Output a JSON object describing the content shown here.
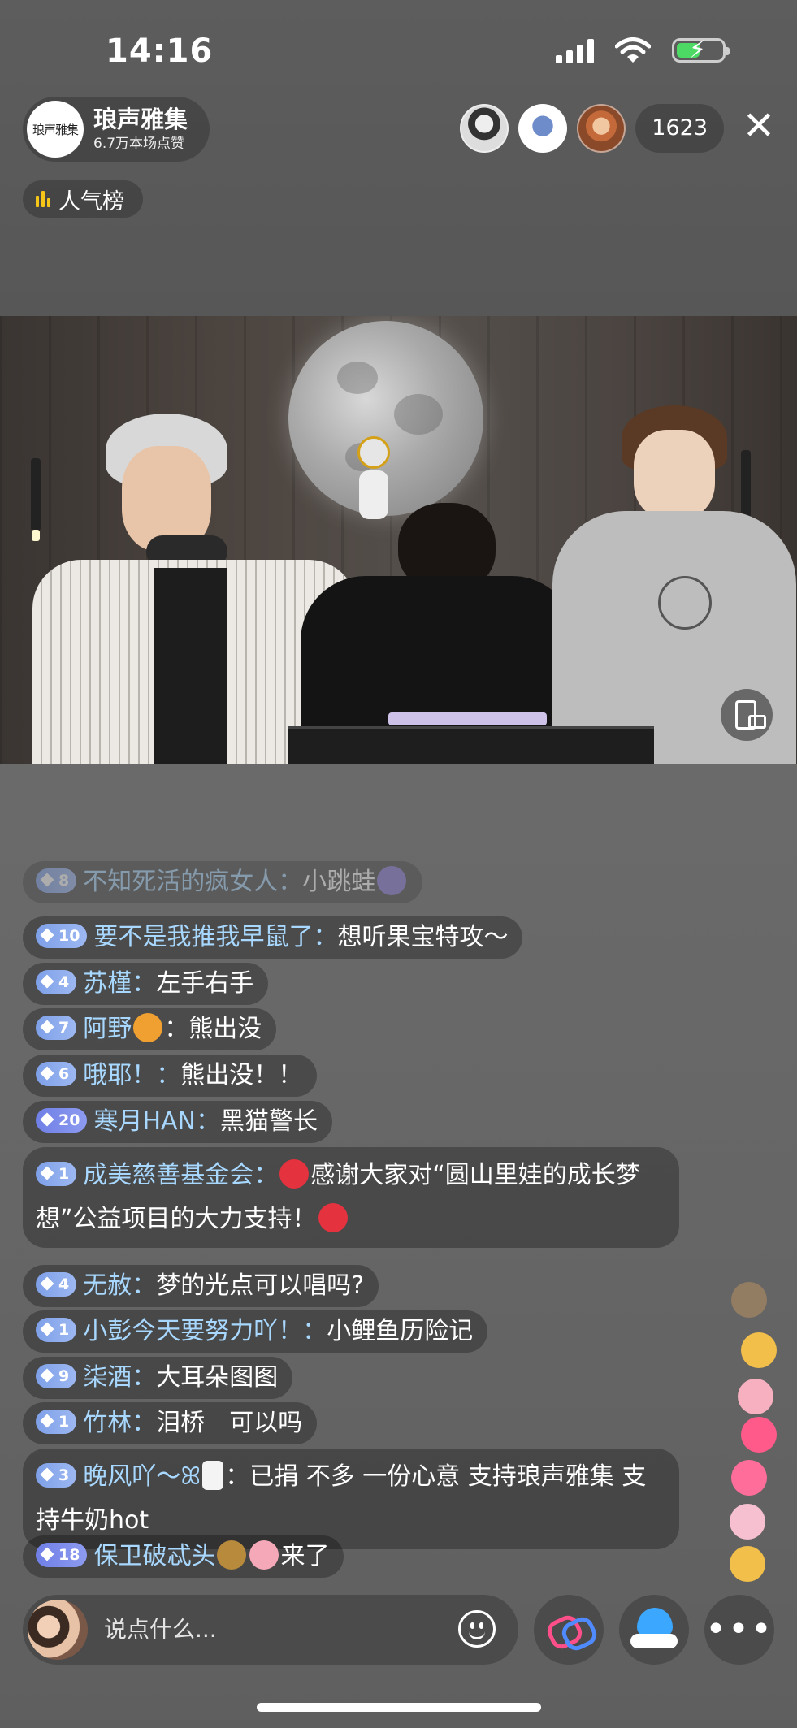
{
  "status": {
    "time": "14:16"
  },
  "host": {
    "avatar_text": "琅声雅集",
    "name": "琅声雅集",
    "likes": "6.7万本场点赞"
  },
  "viewers": {
    "count": "1623"
  },
  "rank": {
    "label": "人气榜"
  },
  "chat": [
    {
      "level": "8",
      "name": "不知死活的疯女人：",
      "text": "小跳蛙",
      "faded": true
    },
    {
      "level": "10",
      "name": "要不是我推我早鼠了：",
      "text": "想听果宝特攻～"
    },
    {
      "level": "4",
      "name": "苏槿：",
      "text": "左手右手"
    },
    {
      "level": "7",
      "name": "阿野",
      "text": "：熊出没"
    },
    {
      "level": "6",
      "name": "哦耶！：",
      "text": "熊出没！！"
    },
    {
      "level": "20",
      "name": "寒月HAN：",
      "text": "黑猫警长"
    },
    {
      "level": "1",
      "name": "成美慈善基金会：",
      "text": "感谢大家对“圆山里娃的成长梦想”公益项目的大力支持！"
    },
    {
      "level": "4",
      "name": "无赦：",
      "text": "梦的光点可以唱吗?"
    },
    {
      "level": "1",
      "name": "小彭今天要努力吖！：",
      "text": "小鲤鱼历险记"
    },
    {
      "level": "9",
      "name": "柒酒：",
      "text": "大耳朵图图"
    },
    {
      "level": "1",
      "name": "竹林：",
      "text": "泪桥　可以吗"
    },
    {
      "level": "3",
      "name": "晚风吖～ꕤ",
      "text": "：已捐 不多 一份心意 支持琅声雅集 支持牛奶hot"
    },
    {
      "level": "18",
      "name": "保卫破忒头",
      "text": "来了"
    }
  ],
  "input": {
    "placeholder": "说点什么..."
  },
  "colors": {
    "username": "#a8d8ff",
    "badge": "#8aa9ee",
    "battery": "#4cd964"
  }
}
